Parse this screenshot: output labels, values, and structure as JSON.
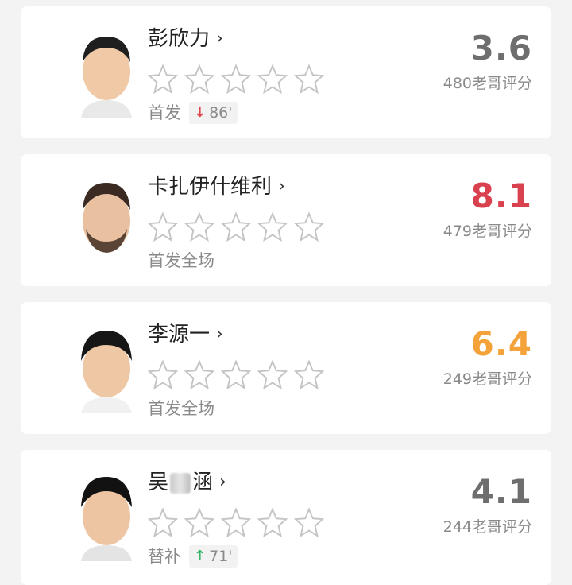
{
  "star_outline_color": "#c4c4c4",
  "players": [
    {
      "name": "彭欣力",
      "status": "首发",
      "sub": {
        "direction": "down",
        "minute": "86'"
      },
      "score": "3.6",
      "score_color": "#6e6e6e",
      "votes": "480老哥评分",
      "avatar": "player-headshot"
    },
    {
      "name": "卡扎伊什维利",
      "status": "首发全场",
      "score": "8.1",
      "score_color": "#d9414e",
      "votes": "479老哥评分",
      "avatar": "player-headshot"
    },
    {
      "name": "李源一",
      "status": "首发全场",
      "score": "6.4",
      "score_color": "#f4a23a",
      "votes": "249老哥评分",
      "avatar": "player-headshot"
    },
    {
      "name_parts": [
        "吴",
        "涵"
      ],
      "status": "替补",
      "sub": {
        "direction": "up",
        "minute": "71'"
      },
      "score": "4.1",
      "score_color": "#6e6e6e",
      "votes": "244老哥评分",
      "avatar": "player-headshot"
    }
  ],
  "chevron_glyph": "›",
  "arrow_glyphs": {
    "down": "↓",
    "up": "↑"
  }
}
